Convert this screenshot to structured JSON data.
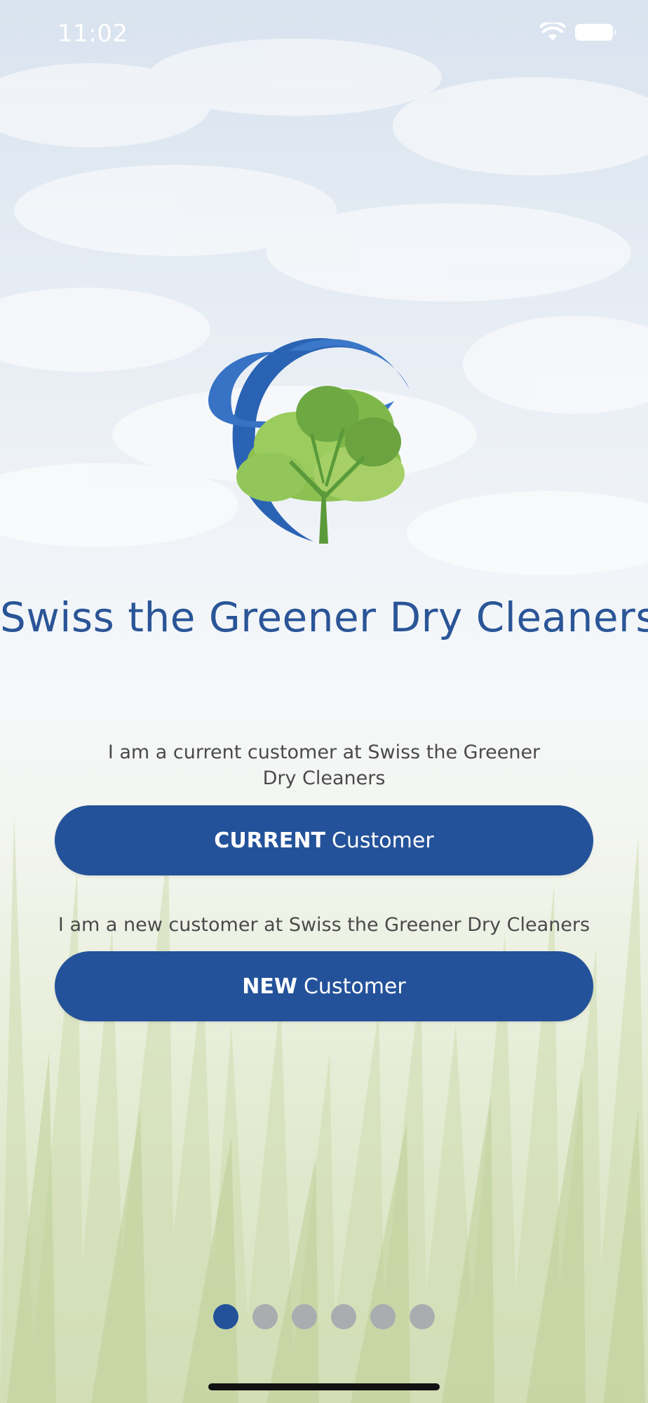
{
  "status_bar": {
    "time": "11:02",
    "icons": [
      "wifi-icon",
      "battery-icon"
    ]
  },
  "logo": {
    "icon": "tree-swoosh-logo-icon"
  },
  "app_title": "Swiss the Greener Dry Cleaners",
  "current_customer": {
    "prompt": "I am a current customer at Swiss the Greener Dry Cleaners",
    "button_strong": "CURRENT",
    "button_light": "Customer"
  },
  "new_customer": {
    "prompt": "I am a new customer at Swiss the Greener Dry Cleaners",
    "button_strong": "NEW",
    "button_light": "Customer"
  },
  "pager": {
    "total_pages": 6,
    "active_page": 1
  },
  "colors": {
    "brand_blue": "#24529a",
    "title_blue": "#2a5597",
    "inactive_dot": "#a9adb0",
    "leaf_green": "#7fb84a"
  }
}
